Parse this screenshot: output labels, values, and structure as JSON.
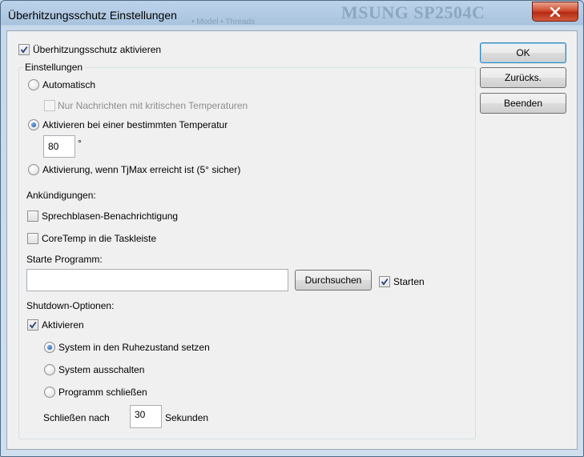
{
  "window": {
    "title": "Überhitzungsschutz Einstellungen",
    "background_text": "MSUNG SP2504C",
    "background_text2": "• Model    • Threads",
    "close_icon": "close-x-icon"
  },
  "buttons": {
    "ok": "OK",
    "reset": "Zurücks.",
    "quit": "Beenden"
  },
  "enable_protection": {
    "label": "Überhitzungsschutz aktivieren",
    "checked": true
  },
  "settings_group": {
    "title": "Einstellungen",
    "automatic": {
      "label": "Automatisch",
      "selected": false
    },
    "critical_only": {
      "label": "Nur Nachrichten mit kritischen Temperaturen",
      "checked": false,
      "disabled": true
    },
    "at_temperature": {
      "label": "Aktivieren bei einer bestimmten Temperatur",
      "selected": true
    },
    "temperature_value": "80",
    "degree_unit": "°",
    "at_tjmax": {
      "label": "Aktivierung, wenn TjMax erreicht ist (5° sicher)",
      "selected": false
    },
    "announcements_label": "Ankündigungen:",
    "balloon": {
      "label": "Sprechblasen-Benachrichtigung",
      "checked": false
    },
    "taskbar": {
      "label": "CoreTemp in die Taskleiste",
      "checked": false
    },
    "start_program_label": "Starte Programm:",
    "program_path": "",
    "browse_button": "Durchsuchen",
    "start": {
      "label": "Starten",
      "checked": true
    },
    "shutdown_label": "Shutdown-Optionen:",
    "shutdown_enable": {
      "label": "Aktivieren",
      "checked": true
    },
    "hibernate": {
      "label": "System in den Ruhezustand setzen",
      "selected": true
    },
    "power_off": {
      "label": "System ausschalten",
      "selected": false
    },
    "close_program": {
      "label": "Programm schließen",
      "selected": false
    },
    "close_after_label": "Schließen nach",
    "close_after_value": "30",
    "seconds_label": "Sekunden"
  },
  "colors": {
    "accent": "#3c7fb1",
    "close_red": "#c94a2e",
    "disabled_text": "#8d8d8d"
  }
}
